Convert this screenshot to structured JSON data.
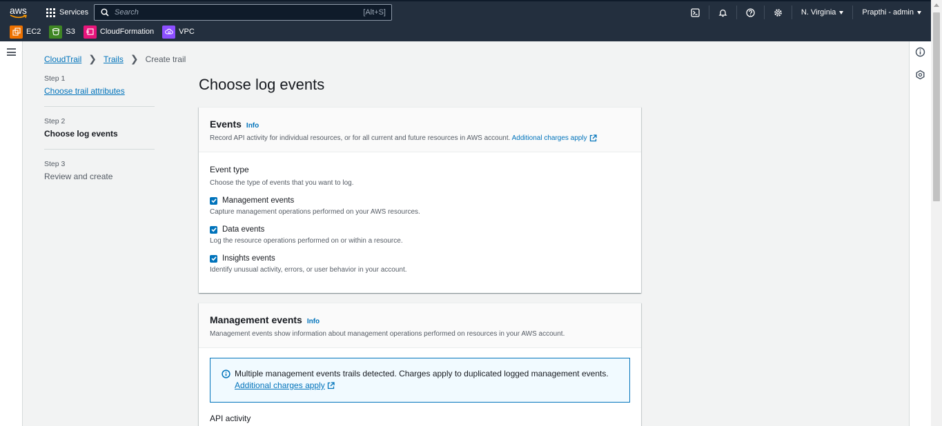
{
  "topbar": {
    "logo": "aws",
    "services_label": "Services",
    "search_placeholder": "Search",
    "search_shortcut": "[Alt+S]",
    "region_label": "N. Virginia",
    "account_label": "Prapthi - admin",
    "icons": [
      "cloudshell-icon",
      "bell-icon",
      "help-icon",
      "settings-icon"
    ],
    "favorites": [
      {
        "label": "EC2",
        "color": "#ed7100"
      },
      {
        "label": "S3",
        "color": "#3f8624"
      },
      {
        "label": "CloudFormation",
        "color": "#e7157b"
      },
      {
        "label": "VPC",
        "color": "#8c4fff"
      }
    ]
  },
  "breadcrumb": {
    "items": [
      "CloudTrail",
      "Trails"
    ],
    "current": "Create trail"
  },
  "steps": [
    {
      "num": "Step 1",
      "label": "Choose trail attributes",
      "state": "link"
    },
    {
      "num": "Step 2",
      "label": "Choose log events",
      "state": "active"
    },
    {
      "num": "Step 3",
      "label": "Review and create",
      "state": "disabled"
    }
  ],
  "page_title": "Choose log events",
  "events_card": {
    "title": "Events",
    "info": "Info",
    "desc": "Record API activity for individual resources, or for all current and future resources in AWS account.",
    "desc_link": "Additional charges apply",
    "event_type_label": "Event type",
    "event_type_desc": "Choose the type of events that you want to log.",
    "options": [
      {
        "label": "Management events",
        "desc": "Capture management operations performed on your AWS resources.",
        "checked": true
      },
      {
        "label": "Data events",
        "desc": "Log the resource operations performed on or within a resource.",
        "checked": true
      },
      {
        "label": "Insights events",
        "desc": "Identify unusual activity, errors, or user behavior in your account.",
        "checked": true
      }
    ]
  },
  "mgmt_card": {
    "title": "Management events",
    "info": "Info",
    "desc": "Management events show information about management operations performed on resources in your AWS account.",
    "alert_text": "Multiple management events trails detected. Charges apply to duplicated logged management events.",
    "alert_link": "Additional charges apply",
    "api_label": "API activity"
  },
  "colors": {
    "nav_bg": "#232f3e",
    "link": "#0073bb",
    "page_bg": "#f2f3f3"
  }
}
